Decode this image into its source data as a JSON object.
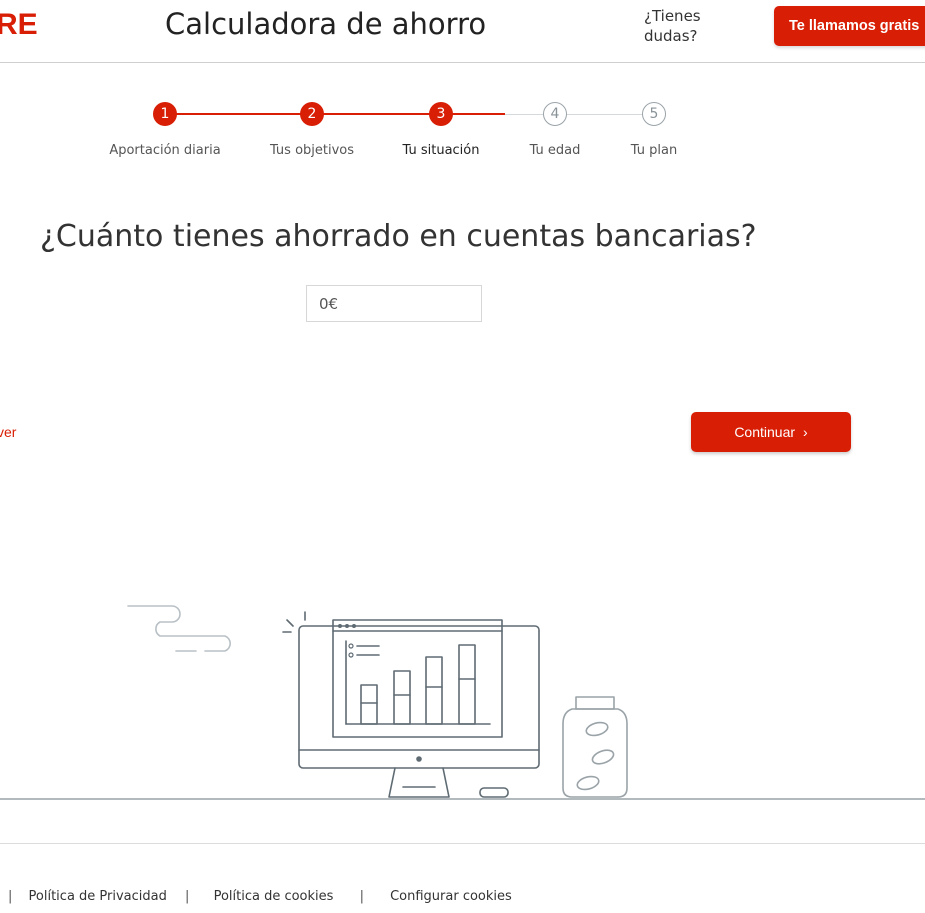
{
  "header": {
    "logo_text": "RE",
    "title": "Calculadora de ahorro",
    "help_text": "¿Tienes dudas?",
    "cta_label": "Te llamamos gratis"
  },
  "stepper": {
    "current_step": 3,
    "steps": [
      {
        "number": "1",
        "label": "Aportación diaria",
        "state": "done"
      },
      {
        "number": "2",
        "label": "Tus objetivos",
        "state": "done"
      },
      {
        "number": "3",
        "label": "Tu situación",
        "state": "current"
      },
      {
        "number": "4",
        "label": "Tu edad",
        "state": "todo"
      },
      {
        "number": "5",
        "label": "Tu plan",
        "state": "todo"
      }
    ]
  },
  "main": {
    "question": "¿Cuánto tienes ahorrado en cuentas bancarias?",
    "amount_value": "0€"
  },
  "nav": {
    "back_label": "ver",
    "continue_label": "Continuar"
  },
  "footer": {
    "links": [
      "Política de Privacidad",
      "Política de cookies",
      "Configurar cookies"
    ]
  },
  "colors": {
    "brand": "#d81e05",
    "illustration_stroke": "#5f6b73"
  }
}
